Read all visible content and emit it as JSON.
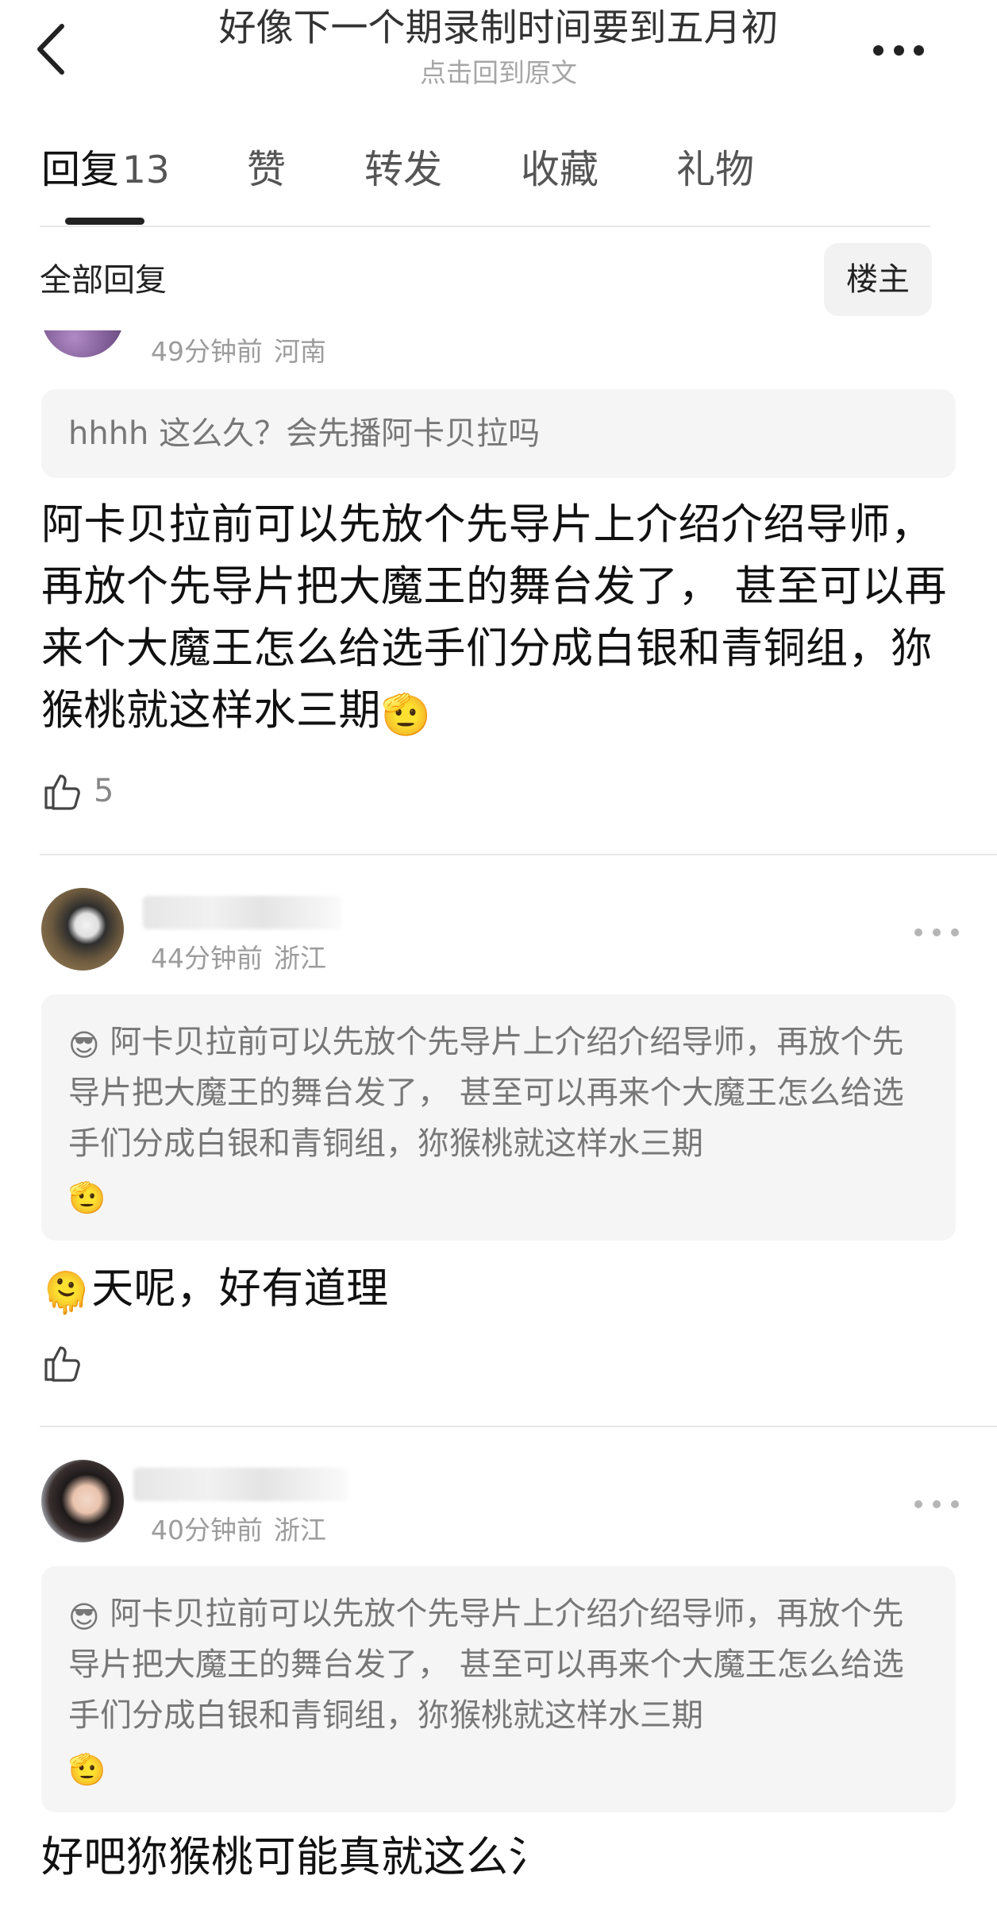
{
  "header": {
    "title": "好像下一个期录制时间要到五月初",
    "subtitle": "点击回到原文"
  },
  "tabs": [
    {
      "label": "回复",
      "count": "13",
      "active": true
    },
    {
      "label": "赞"
    },
    {
      "label": "转发"
    },
    {
      "label": "收藏"
    },
    {
      "label": "礼物"
    }
  ],
  "filter": {
    "label": "全部回复",
    "owner_button": "楼主"
  },
  "comments": [
    {
      "time": "49分钟前",
      "location": "河南",
      "quote": "hhhh 这么久？会先播阿卡贝拉吗",
      "body": "阿卡贝拉前可以先放个先导片上介绍介绍导师，再放个先导片把大魔王的舞台发了， 甚至可以再来个大魔王怎么给选手们分成白银和青铜组，狝猴桃就这样水三期",
      "body_emoji": "🫡",
      "likes": "5"
    },
    {
      "time": "44分钟前",
      "location": "浙江",
      "quote_emoji": "😎",
      "quote": "阿卡贝拉前可以先放个先导片上介绍介绍导师，再放个先导片把大魔王的舞台发了， 甚至可以再来个大魔王怎么给选手们分成白银和青铜组，狝猴桃就这样水三期",
      "quote_end_emoji": "🫡",
      "body_emoji": "🫠",
      "body": "天呢，好有道理"
    },
    {
      "time": "40分钟前",
      "location": "浙江",
      "quote_emoji": "😎",
      "quote": "阿卡贝拉前可以先放个先导片上介绍介绍导师，再放个先导片把大魔王的舞台发了， 甚至可以再来个大魔王怎么给选手们分成白银和青铜组，狝猴桃就这样水三期",
      "quote_end_emoji": "🫡",
      "body": "好吧狝猴桃可能真就这么氵"
    }
  ],
  "icons": {
    "back": "chevron-left-icon",
    "more": "more-horizontal-icon",
    "like": "thumbs-up-icon"
  }
}
